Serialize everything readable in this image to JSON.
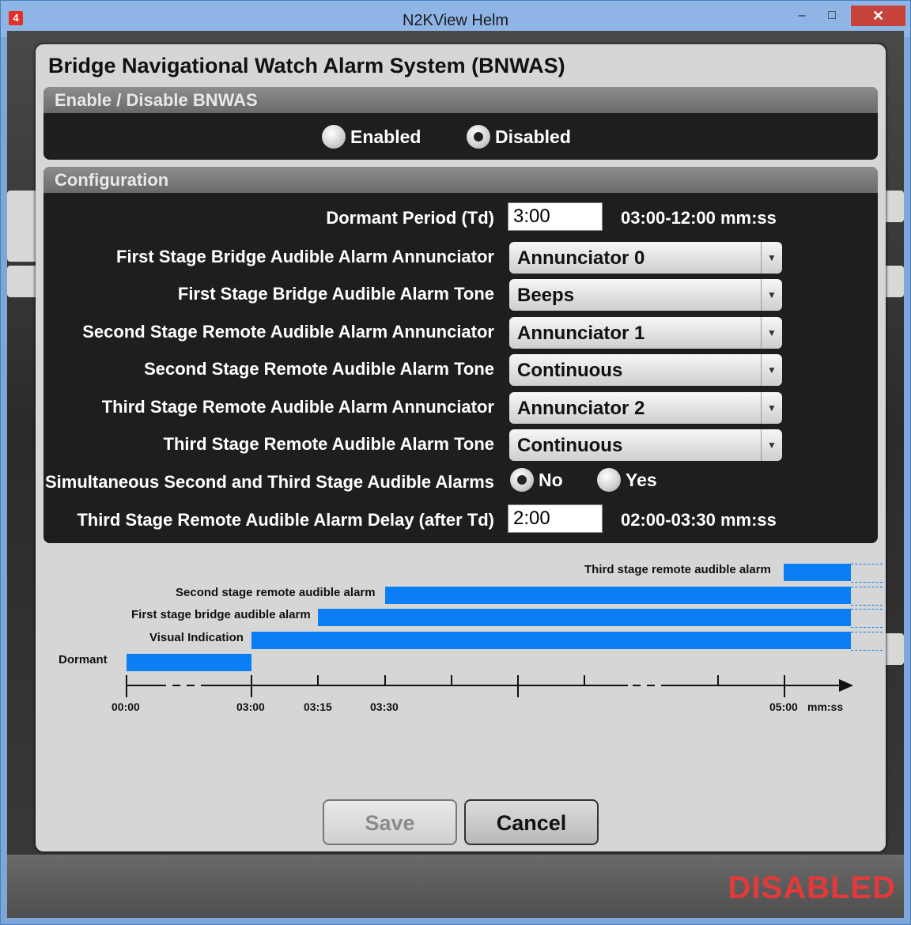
{
  "window": {
    "title": "N2KView Helm",
    "app_icon": "4",
    "minimize": "–",
    "maximize": "□",
    "close": "✕"
  },
  "status": "DISABLED",
  "dialog": {
    "title": "Bridge Navigational Watch Alarm System (BNWAS)",
    "enable_panel": {
      "heading": "Enable / Disable BNWAS",
      "options": [
        {
          "label": "Enabled",
          "selected": false
        },
        {
          "label": "Disabled",
          "selected": true
        }
      ]
    },
    "config_panel": {
      "heading": "Configuration",
      "dormant": {
        "label": "Dormant Period (Td)",
        "value": "3:00",
        "hint": "03:00-12:00 mm:ss"
      },
      "rows": [
        {
          "label": "First Stage Bridge Audible Alarm Annunciator",
          "value": "Annunciator 0"
        },
        {
          "label": "First Stage Bridge Audible Alarm Tone",
          "value": "Beeps"
        },
        {
          "label": "Second Stage Remote Audible Alarm Annunciator",
          "value": "Annunciator 1"
        },
        {
          "label": "Second Stage Remote Audible Alarm Tone",
          "value": "Continuous"
        },
        {
          "label": "Third Stage Remote Audible Alarm Annunciator",
          "value": "Annunciator 2"
        },
        {
          "label": "Third Stage Remote Audible Alarm Tone",
          "value": "Continuous"
        }
      ],
      "simultaneous": {
        "label": "Simultaneous Second and Third Stage Audible Alarms",
        "options": [
          {
            "label": "No",
            "selected": true
          },
          {
            "label": "Yes",
            "selected": false
          }
        ]
      },
      "delay": {
        "label": "Third Stage Remote Audible Alarm Delay (after Td)",
        "value": "2:00",
        "hint": "02:00-03:30 mm:ss"
      }
    },
    "timeline": {
      "labels": [
        "Third stage remote audible alarm",
        "Second stage remote audible alarm",
        "First stage bridge audible alarm",
        "Visual Indication",
        "Dormant"
      ],
      "ticks": [
        "00:00",
        "03:00",
        "03:15",
        "03:30",
        "05:00"
      ],
      "unit": "mm:ss"
    },
    "buttons": {
      "save": "Save",
      "cancel": "Cancel"
    }
  }
}
